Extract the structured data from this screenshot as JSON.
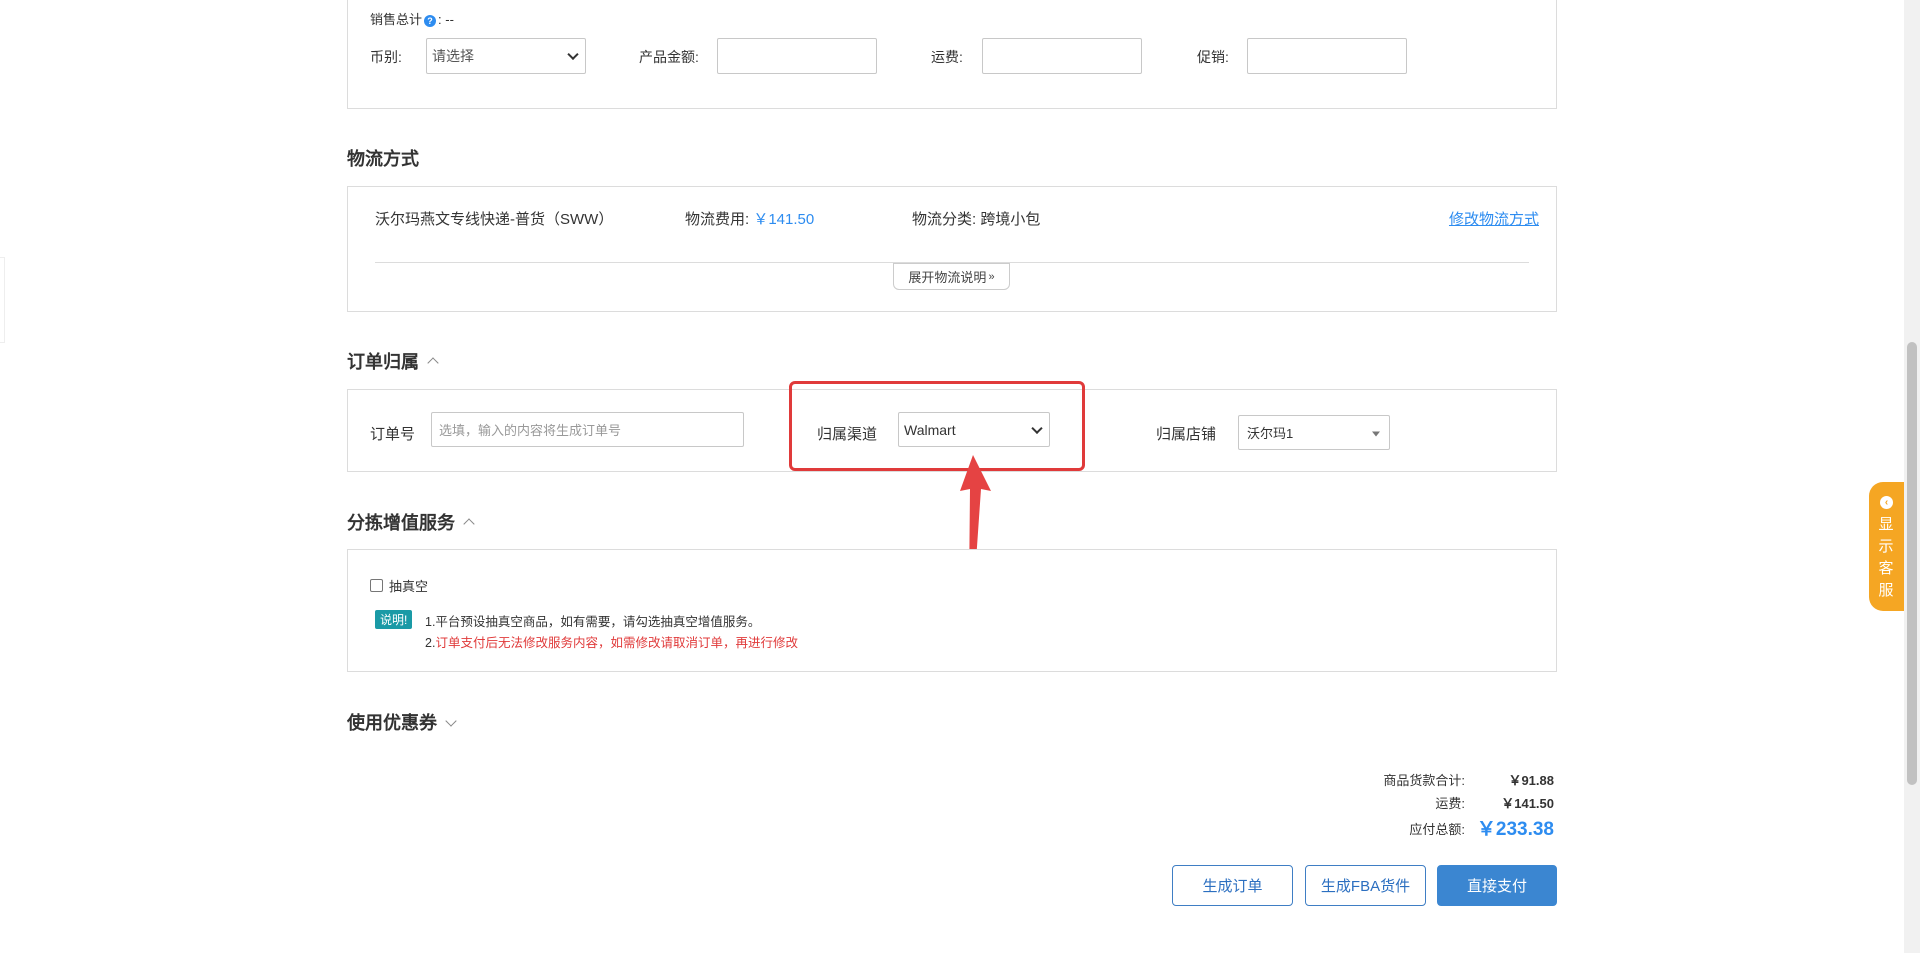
{
  "top_form": {
    "sales_total_label": "销售总计",
    "sales_total_value": "--",
    "currency_label": "币别:",
    "currency_value": "请选择",
    "product_amount_label": "产品金额:",
    "shipping_fee_label": "运费:",
    "promotion_label": "促销:"
  },
  "logistics": {
    "title": "物流方式",
    "method_name": "沃尔玛燕文专线快递-普货（SWW）",
    "fee_label": "物流费用:",
    "fee_value": "￥141.50",
    "category_label": "物流分类:",
    "category_value": "跨境小包",
    "modify_link": "修改物流方式",
    "expand_label": "展开物流说明"
  },
  "order_attribution": {
    "title": "订单归属",
    "order_no_label": "订单号",
    "order_no_placeholder": "选填，输入的内容将生成订单号",
    "channel_label": "归属渠道",
    "channel_value": "Walmart",
    "store_label": "归属店铺",
    "store_value": "沃尔玛1"
  },
  "sorting_service": {
    "title": "分拣增值服务",
    "checkbox_label": "抽真空",
    "note_badge": "说明!",
    "note_line1": "1.平台预设抽真空商品，如有需要，请勾选抽真空增值服务。",
    "note_line2_prefix": "2.",
    "note_line2": "订单支付后无法修改服务内容，如需修改请取消订单，再进行修改"
  },
  "coupon": {
    "title": "使用优惠券"
  },
  "summary": {
    "goods_label": "商品货款合计:",
    "goods_value": "￥91.88",
    "shipping_label": "运费:",
    "shipping_value": "￥141.50",
    "total_label": "应付总额:",
    "total_value": "￥233.38"
  },
  "actions": {
    "generate_order": "生成订单",
    "generate_fba": "生成FBA货件",
    "pay_direct": "直接支付"
  },
  "customer_service": {
    "label": "显示客服"
  },
  "colors": {
    "accent_blue": "#2d8cf0",
    "highlight_red": "#e03a3a",
    "badge_teal": "#1a9aa6",
    "service_orange": "#f5a623"
  }
}
